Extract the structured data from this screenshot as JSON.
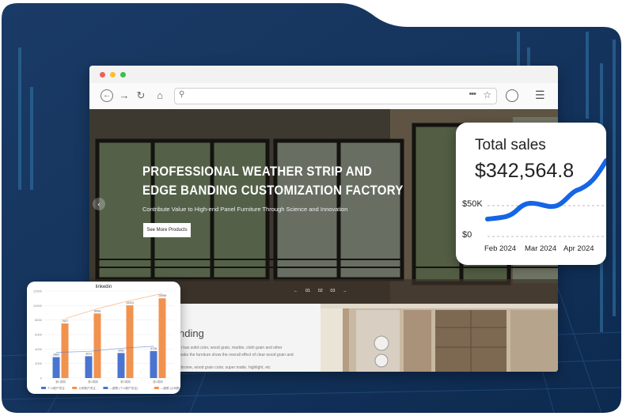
{
  "browser": {
    "url": "",
    "window_dots": [
      "#f25f58",
      "#fbbe2e",
      "#38c149"
    ]
  },
  "hero": {
    "title_line1": "PROFESSIONAL WEATHER STRIP AND",
    "title_line2": "EDGE BANDING CUSTOMIZATION FACTORY",
    "subtitle": "Contribute Value to High-end Panel Furniture Through Science and Innovation",
    "cta": "See More Products",
    "pager": [
      "←",
      "01",
      "02",
      "03",
      "→"
    ]
  },
  "lower_section": {
    "title": "nding",
    "lines": [
      "in has solid color, wood grain, marble, cloth grain and other",
      "make the furniture show the overall effect of clear wood grain and",
      "",
      "chrome, wood grain color, super matte, highlight, etc"
    ]
  },
  "sales_card": {
    "title": "Total sales",
    "value": "$342,564.8",
    "y_labels": [
      "$50K",
      "$0"
    ],
    "x_labels": [
      "Feb 2024",
      "Mar 2024",
      "Apr 2024"
    ],
    "accent": "#1565e6"
  },
  "linkedin_card": {
    "chart_data": {
      "type": "bar",
      "title": "linkedin",
      "categories": [
        "第1周期",
        "第2周期",
        "第3周期",
        "第4周期"
      ],
      "ylim": [
        0,
        12000
      ],
      "y_ticks": [
        "12000",
        "10000",
        "8000",
        "6000",
        "4000",
        "2000",
        "0"
      ],
      "series": [
        {
          "name": "个人账户关注",
          "color": "#4a74d0",
          "values": [
            2883,
            3013,
            3452,
            3728
          ]
        },
        {
          "name": "公司账户关注",
          "color": "#f2924f",
          "values": [
            7527,
            8908,
            10024,
            10998
          ]
        }
      ],
      "legend": [
        "个人账户关注",
        "公司账户关注",
        "—趋势 (个人账户关注)",
        "—趋势 (公司账户关注)"
      ]
    }
  }
}
